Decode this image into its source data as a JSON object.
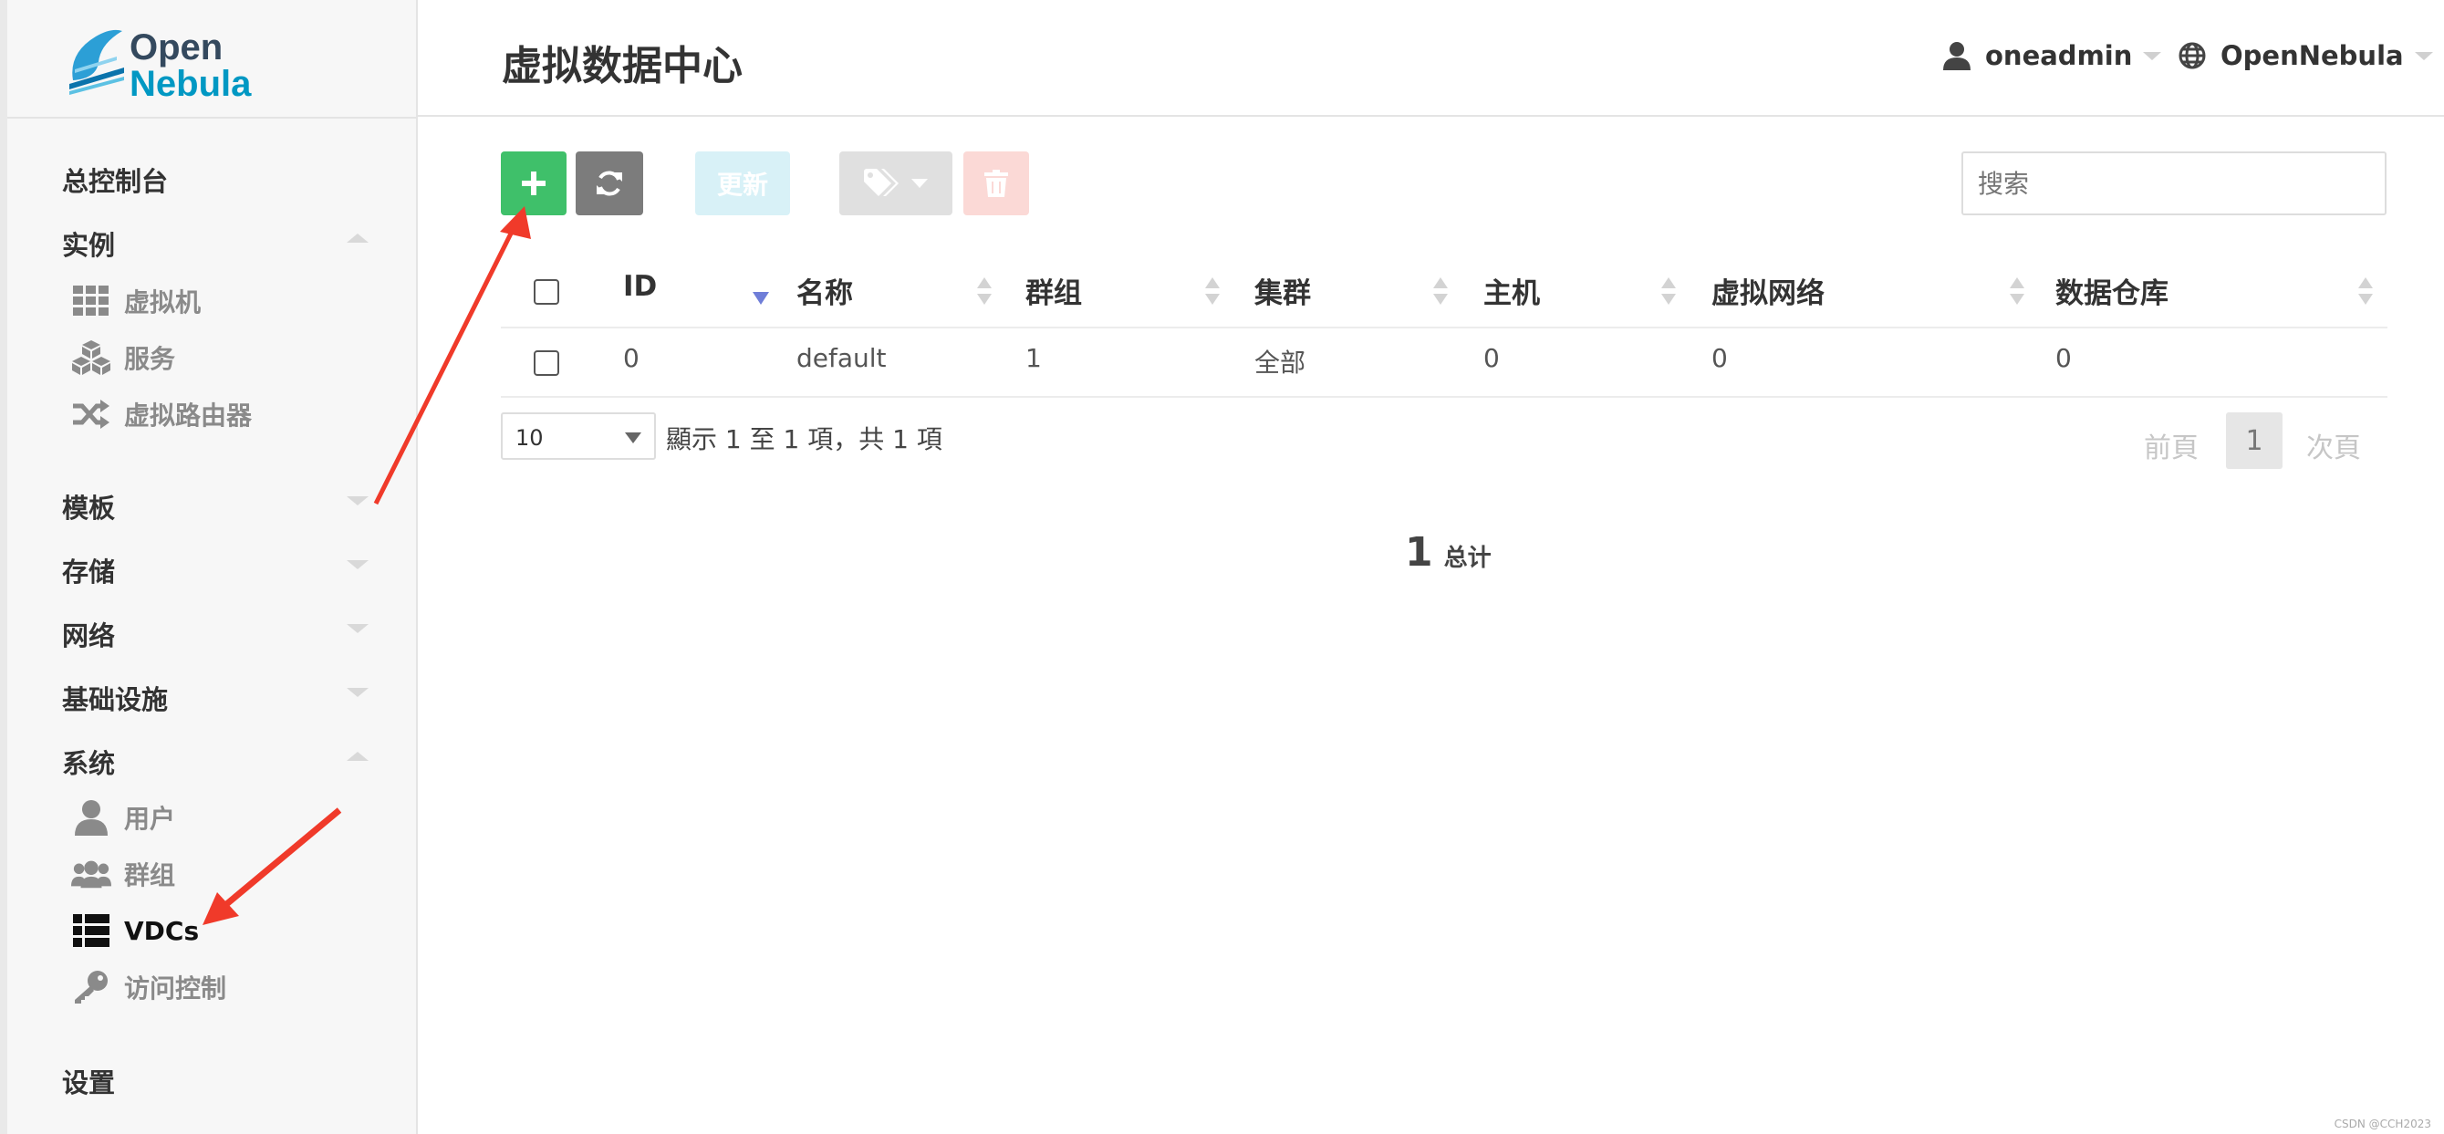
{
  "brand": {
    "line1": "Open",
    "line2": "Nebula"
  },
  "header": {
    "title": "虚拟数据中心",
    "user": "oneadmin",
    "zone": "OpenNebula"
  },
  "sidebar": {
    "dashboard": "总控制台",
    "instances": "实例",
    "vms": "虚拟机",
    "services": "服务",
    "vrouters": "虚拟路由器",
    "templates": "模板",
    "storage": "存储",
    "network": "网络",
    "infrastructure": "基础设施",
    "system": "系统",
    "users": "用户",
    "groups": "群组",
    "vdcs": "VDCs",
    "acl": "访问控制",
    "settings": "设置"
  },
  "toolbar": {
    "update_label": "更新",
    "search_placeholder": "搜索"
  },
  "table": {
    "columns": [
      "ID",
      "名称",
      "群组",
      "集群",
      "主机",
      "虚拟网络",
      "数据仓库"
    ],
    "rows": [
      [
        "0",
        "default",
        "1",
        "全部",
        "0",
        "0",
        "0"
      ]
    ]
  },
  "pagination": {
    "page_size": "10",
    "info": "顯示 1 至 1 項，共 1 項",
    "prev": "前頁",
    "current": "1",
    "next": "次頁"
  },
  "summary": {
    "count": "1",
    "label": "总计"
  },
  "watermark": "CSDN @CCH2023",
  "colors": {
    "create": "#3fc06a",
    "refresh": "#7c7c7c",
    "brand": "#0098c3",
    "annotation": "#f03a2a"
  }
}
